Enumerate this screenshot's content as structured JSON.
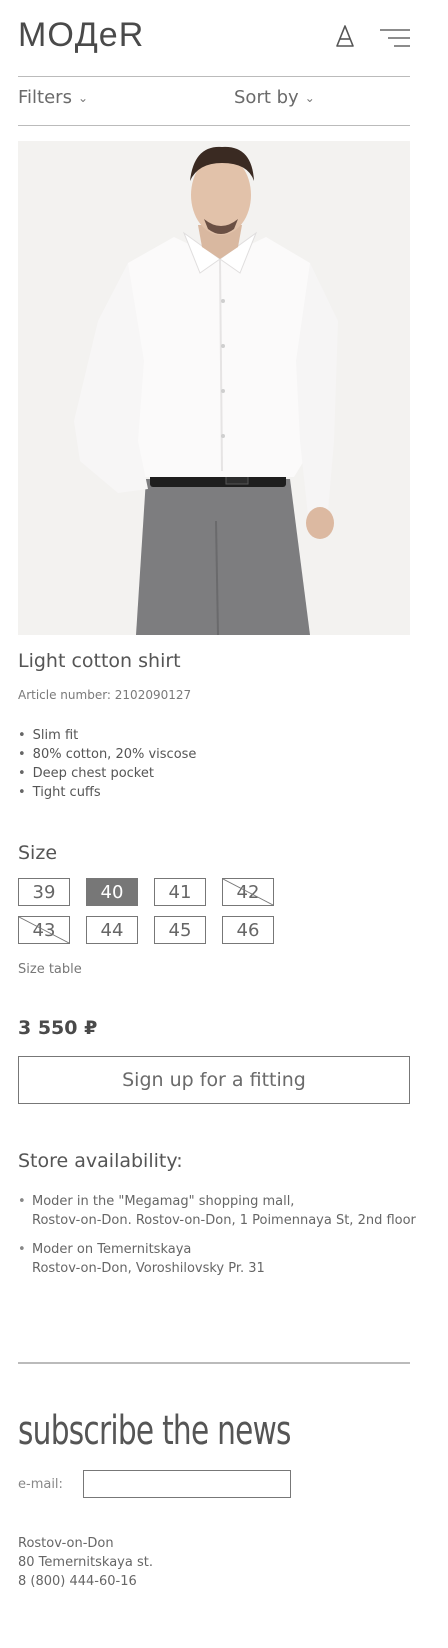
{
  "header": {
    "logo": "MOДeR",
    "bag_icon": "shopping-bag-icon",
    "menu_icon": "hamburger-menu-icon"
  },
  "toolbar": {
    "filters_label": "Filters",
    "sort_label": "Sort by",
    "chevron": "⌄"
  },
  "product": {
    "image": "man-in-white-shirt-photo",
    "title": "Light cotton shirt",
    "article_label": "Article number: 2102090127",
    "features": [
      "Slim fit",
      "80% cotton, 20% viscose",
      "Deep chest pocket",
      "Tight cuffs"
    ],
    "size_heading": "Size",
    "sizes": [
      {
        "label": "39",
        "state": "available"
      },
      {
        "label": "40",
        "state": "selected"
      },
      {
        "label": "41",
        "state": "available"
      },
      {
        "label": "42",
        "state": "unavailable"
      },
      {
        "label": "43",
        "state": "unavailable"
      },
      {
        "label": "44",
        "state": "available"
      },
      {
        "label": "45",
        "state": "available"
      },
      {
        "label": "46",
        "state": "available"
      }
    ],
    "size_table_link": "Size table",
    "price": "3 550 ₽",
    "fitting_button": "Sign up for a fitting"
  },
  "availability": {
    "heading": "Store availability:",
    "stores": [
      {
        "line1": "Moder in the \"Megamag\" shopping mall,",
        "line2": "Rostov-on-Don. Rostov-on-Don, 1 Poimennaya St, 2nd floor"
      },
      {
        "line1": "Moder on Temernitskaya",
        "line2": "Rostov-on-Don, Voroshilovsky Pr. 31"
      }
    ]
  },
  "footer": {
    "subscribe_heading": "subscribe the news",
    "email_label": "e-mail:",
    "email_value": "",
    "address_city": "Rostov-on-Don",
    "address_street": "80 Temernitskaya st.",
    "phone": "8 (800) 444-60-16"
  },
  "colors": {
    "text": "#555555",
    "border": "#777777",
    "selected_size_bg": "#777777",
    "photo_bg": "#f2f1ef"
  }
}
